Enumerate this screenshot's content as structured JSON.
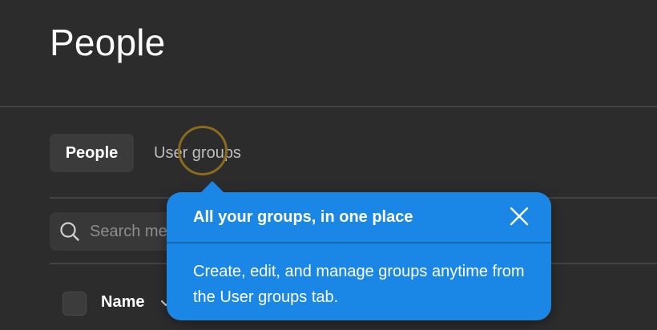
{
  "header": {
    "title": "People"
  },
  "tabs": [
    {
      "label": "People",
      "active": true
    },
    {
      "label": "User groups",
      "active": false
    }
  ],
  "search": {
    "placeholder": "Search members",
    "icon": "search-icon"
  },
  "table": {
    "columns": [
      {
        "label": "Name",
        "sortable": true
      }
    ]
  },
  "coachmark": {
    "title": "All your groups, in one place",
    "body": "Create, edit, and manage groups anytime from the User groups tab.",
    "close_icon": "close-icon"
  },
  "colors": {
    "background": "#2c2c2c",
    "accent": "#1a87e6",
    "focus_ring": "#8a6a1c"
  }
}
